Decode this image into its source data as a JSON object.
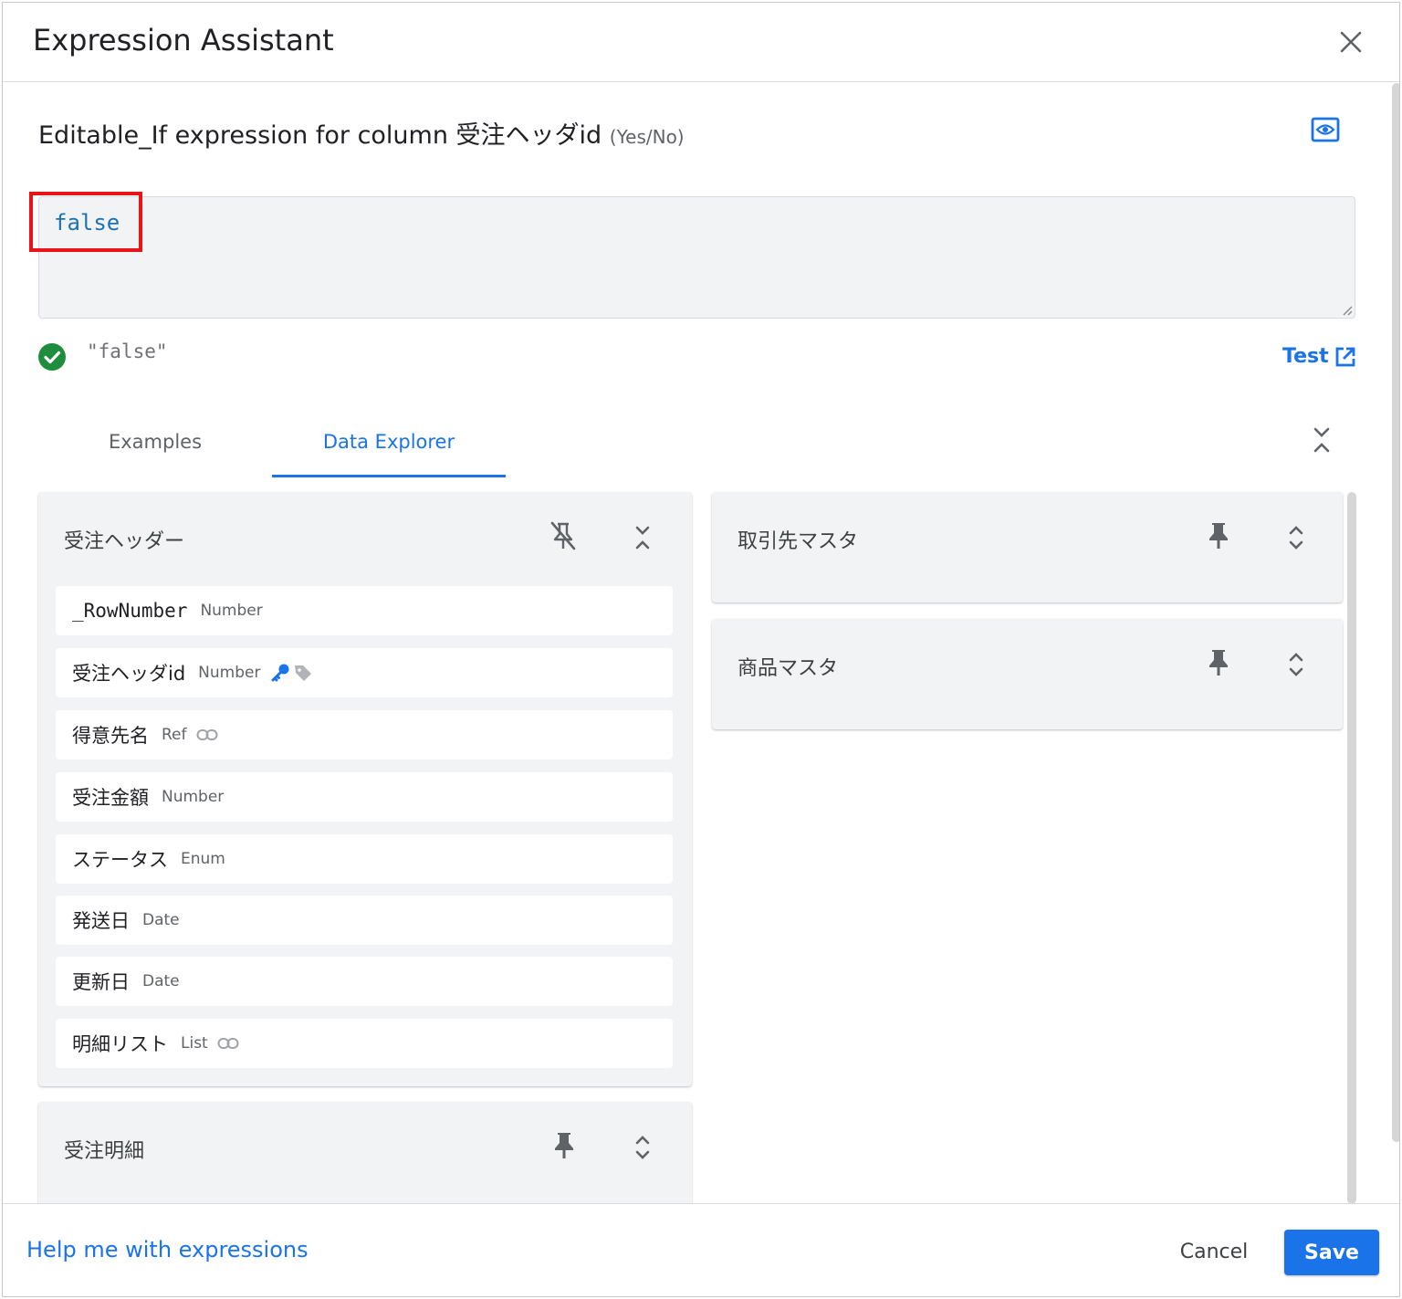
{
  "dialog": {
    "title": "Expression Assistant",
    "close_icon": "close-icon"
  },
  "expression": {
    "heading": "Editable_If expression for column 受注ヘッダid",
    "type_hint": "(Yes/No)",
    "preview_icon": "eye-icon",
    "code": "false",
    "result": "\"false\"",
    "status_icon": "check-circle-icon",
    "test_label": "Test",
    "test_icon": "open-in-new-icon"
  },
  "tabs": [
    {
      "label": "Examples",
      "active": false
    },
    {
      "label": "Data Explorer",
      "active": true
    }
  ],
  "tables": {
    "main": {
      "name": "受注ヘッダー",
      "pinned": false,
      "columns": [
        {
          "name": "_RowNumber",
          "type": "Number"
        },
        {
          "name": "受注ヘッダid",
          "type": "Number",
          "icons": [
            "key-icon",
            "label-icon"
          ]
        },
        {
          "name": "得意先名",
          "type": "Ref",
          "icons": [
            "link-icon"
          ]
        },
        {
          "name": "受注金額",
          "type": "Number"
        },
        {
          "name": "ステータス",
          "type": "Enum"
        },
        {
          "name": "発送日",
          "type": "Date"
        },
        {
          "name": "更新日",
          "type": "Date"
        },
        {
          "name": "明細リスト",
          "type": "List",
          "icons": [
            "link-icon"
          ]
        }
      ]
    },
    "detail": {
      "name": "受注明細"
    },
    "customer": {
      "name": "取引先マスタ"
    },
    "product": {
      "name": "商品マスタ"
    }
  },
  "colors": {
    "accent": "#1a73e8",
    "success": "#1e8e3e",
    "highlight": "#e8141a"
  },
  "footer": {
    "help_label": "Help me with expressions",
    "cancel_label": "Cancel",
    "save_label": "Save"
  }
}
